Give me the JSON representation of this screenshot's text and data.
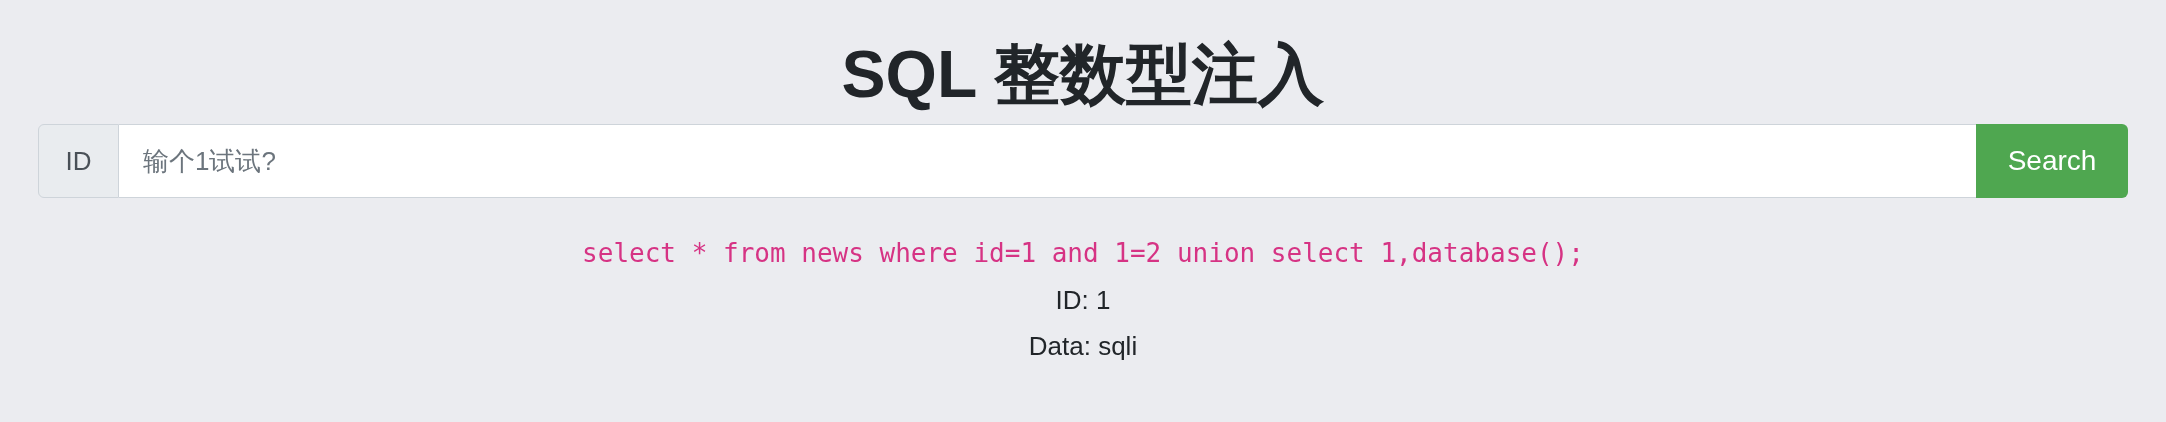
{
  "title": "SQL 整数型注入",
  "search": {
    "addon": "ID",
    "placeholder": "输个1试试?",
    "button": "Search"
  },
  "query": "select * from news where id=1 and 1=2 union select 1,database();",
  "results": [
    "ID: 1",
    "Data: sqli"
  ]
}
